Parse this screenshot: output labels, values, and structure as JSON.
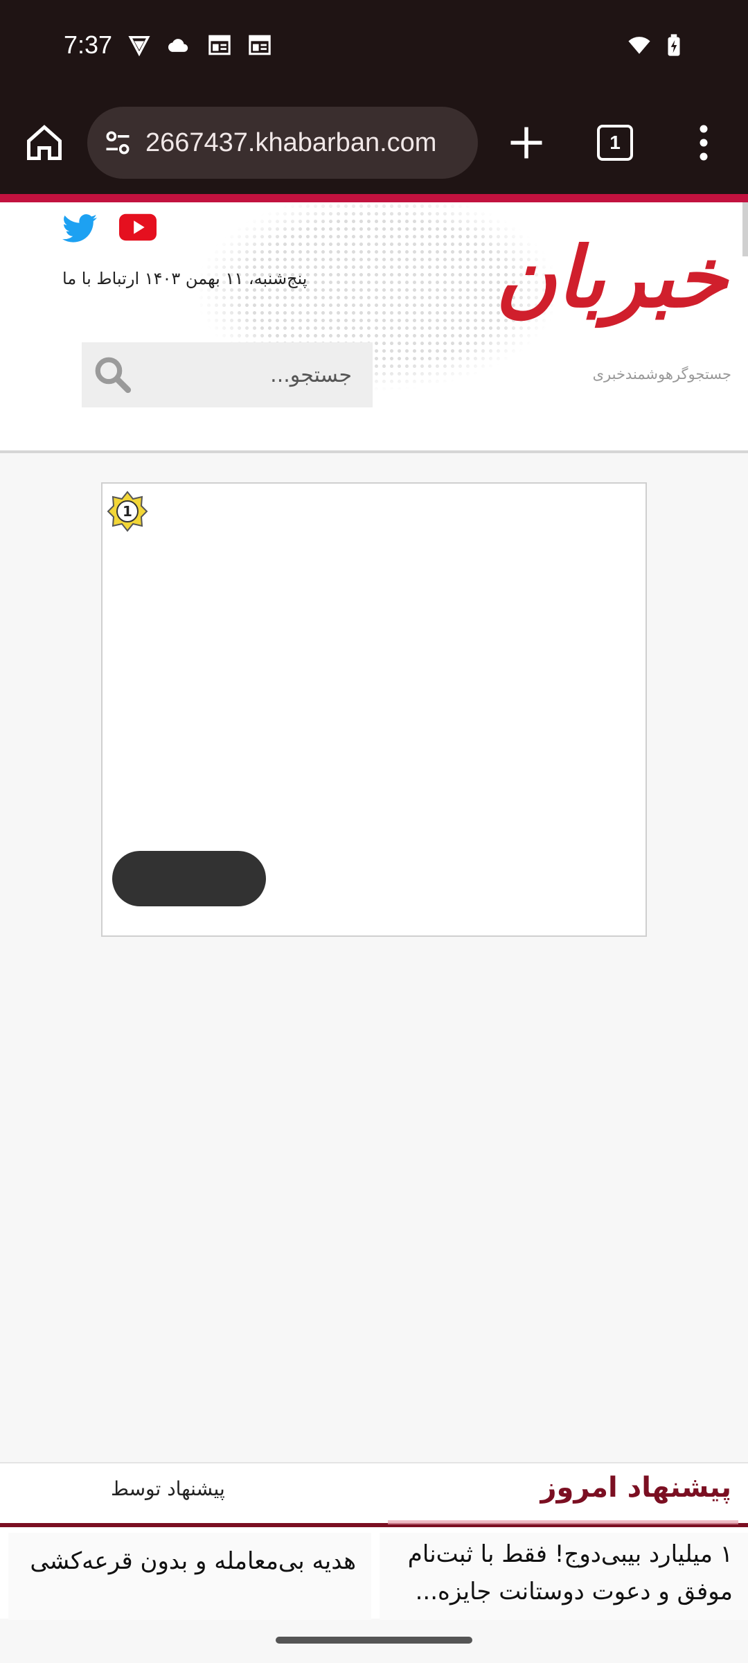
{
  "status_bar": {
    "time": "7:37",
    "icons": [
      "vpn-shield-icon",
      "cloud-icon",
      "news-app-icon",
      "news-app-icon",
      "wifi-icon",
      "battery-charging-icon"
    ]
  },
  "browser": {
    "url": "2667437.khabarban.com",
    "tab_count": "1",
    "icons": [
      "home-icon",
      "site-settings-icon",
      "new-tab-icon",
      "tab-switcher-icon",
      "more-menu-icon"
    ]
  },
  "header": {
    "date_contact": "پنج‌شنبه، ۱۱ بهمن ۱۴۰۳  ارتباط با ما",
    "search_placeholder": "جستجو...",
    "logo_text": "خبربان",
    "tagline": "جستجوگرهوشمندخبری",
    "social": [
      "twitter-icon",
      "youtube-icon"
    ]
  },
  "ad": {
    "badge": "1",
    "button_label": ""
  },
  "recommendations": {
    "title": "پیشنهاد امروز",
    "provided_by": "پیشنهاد توسط",
    "items": [
      "۱ میلیارد بیبی‌دوج! فقط با ثبت‌نام موفق و دعوت دوستانت جایزه...",
      "هدیه بی‌معامله و بدون قرعه‌کشی"
    ]
  },
  "colors": {
    "browser_bar": "#1f1414",
    "accent_red": "#c2123f",
    "reco_title": "#7b0f22"
  }
}
